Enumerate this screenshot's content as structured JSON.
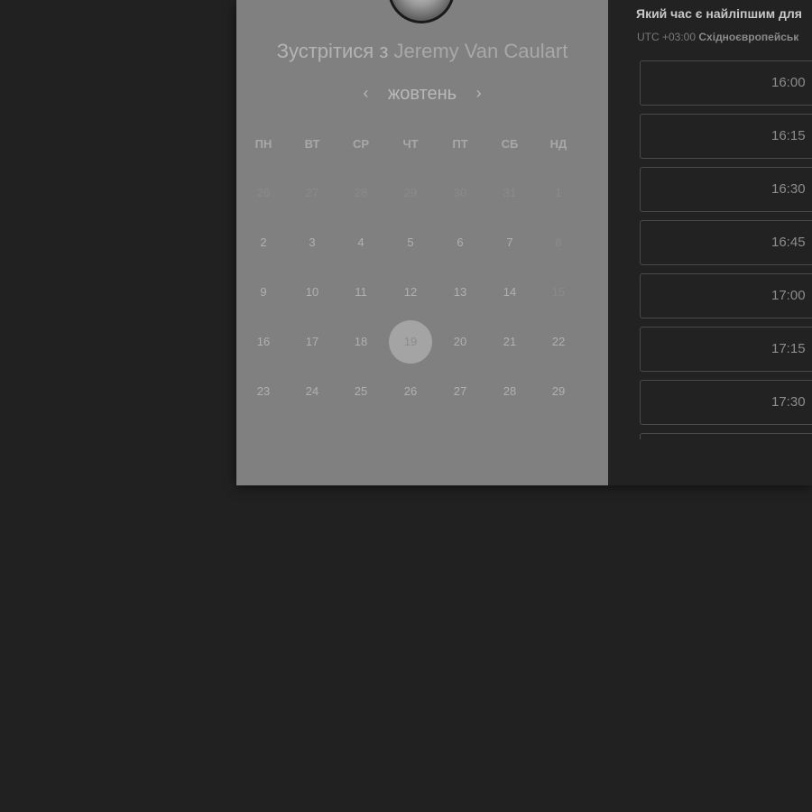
{
  "meeting": {
    "title_prefix": "Зустрітися з",
    "host_name": "Jeremy Van Caulart"
  },
  "calendar": {
    "month": "жовтень",
    "prev_icon": "chevron-left-icon",
    "next_icon": "chevron-right-icon",
    "weekdays": [
      "ПН",
      "ВТ",
      "СР",
      "ЧТ",
      "ПТ",
      "СБ",
      "НД"
    ],
    "weeks": [
      [
        "26",
        "27",
        "28",
        "29",
        "30",
        "31",
        "1"
      ],
      [
        "2",
        "3",
        "4",
        "5",
        "6",
        "7",
        "8"
      ],
      [
        "9",
        "10",
        "11",
        "12",
        "13",
        "14",
        "15"
      ],
      [
        "16",
        "17",
        "18",
        "19",
        "20",
        "21",
        "22"
      ],
      [
        "23",
        "24",
        "25",
        "26",
        "27",
        "28",
        "29"
      ]
    ],
    "selected_day": "19"
  },
  "times": {
    "question": "Який час є найліпшим для",
    "timezone_offset": "UTC +03:00",
    "timezone_name": "Східноєвропейськ",
    "slots": [
      "16:00",
      "16:15",
      "16:30",
      "16:45",
      "17:00",
      "17:15",
      "17:30",
      ""
    ]
  },
  "colors": {
    "page_background": "#212121",
    "calendar_panel": "#808080",
    "selected_day_fill": "#a4a4a4",
    "times_panel": "#222222"
  }
}
